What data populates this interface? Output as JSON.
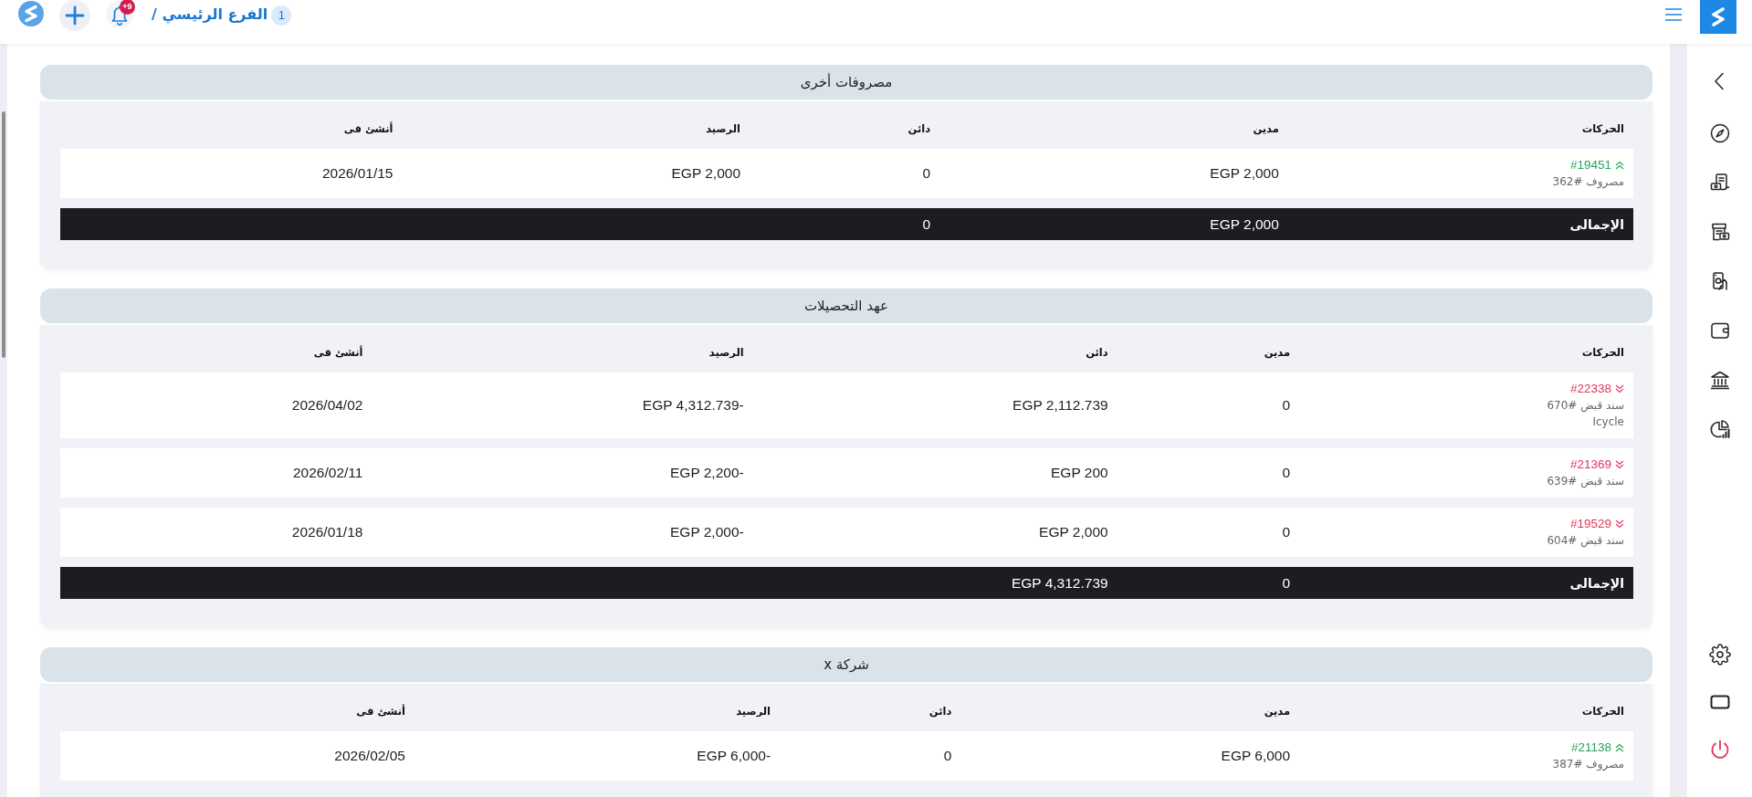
{
  "topbar": {
    "breadcrumb": "الفرع الرئيسي /",
    "branch_badge": "1",
    "notification_badge": "+9"
  },
  "sections": [
    {
      "title": "مصروفات أخرى",
      "columns": [
        "الحركات",
        "مدين",
        "دائن",
        "الرصيد",
        "أنشئ فى"
      ],
      "rows": [
        {
          "kind": "up",
          "ref": "#19451",
          "lines": [
            "مصروف #362"
          ],
          "debit": "EGP 2,000",
          "credit": "0",
          "balance": "EGP 2,000",
          "created": "2026/01/15"
        }
      ],
      "totals": {
        "label": "الإجمالى",
        "debit": "EGP 2,000",
        "credit": "0"
      }
    },
    {
      "title": "عهد التحصيلات",
      "columns": [
        "الحركات",
        "مدين",
        "دائن",
        "الرصيد",
        "أنشئ فى"
      ],
      "rows": [
        {
          "kind": "down",
          "ref": "#22338",
          "lines": [
            "سند قبض #670",
            "Icycle"
          ],
          "debit": "0",
          "credit": "EGP 2,112.739",
          "balance": "-EGP 4,312.739",
          "created": "2026/04/02"
        },
        {
          "kind": "down",
          "ref": "#21369",
          "lines": [
            "سند قبض #639"
          ],
          "debit": "0",
          "credit": "EGP 200",
          "balance": "-EGP 2,200",
          "created": "2026/02/11"
        },
        {
          "kind": "down",
          "ref": "#19529",
          "lines": [
            "سند قبض #604"
          ],
          "debit": "0",
          "credit": "EGP 2,000",
          "balance": "-EGP 2,000",
          "created": "2026/01/18"
        }
      ],
      "totals": {
        "label": "الإجمالى",
        "debit": "0",
        "credit": "EGP 4,312.739"
      }
    },
    {
      "title": "شركة x",
      "columns": [
        "الحركات",
        "مدين",
        "دائن",
        "الرصيد",
        "أنشئ فى"
      ],
      "rows": [
        {
          "kind": "up",
          "ref": "#21138",
          "lines": [
            "مصروف #387"
          ],
          "debit": "EGP 6,000",
          "credit": "0",
          "balance": "-EGP 6,000",
          "created": "2026/02/05"
        }
      ]
    }
  ]
}
